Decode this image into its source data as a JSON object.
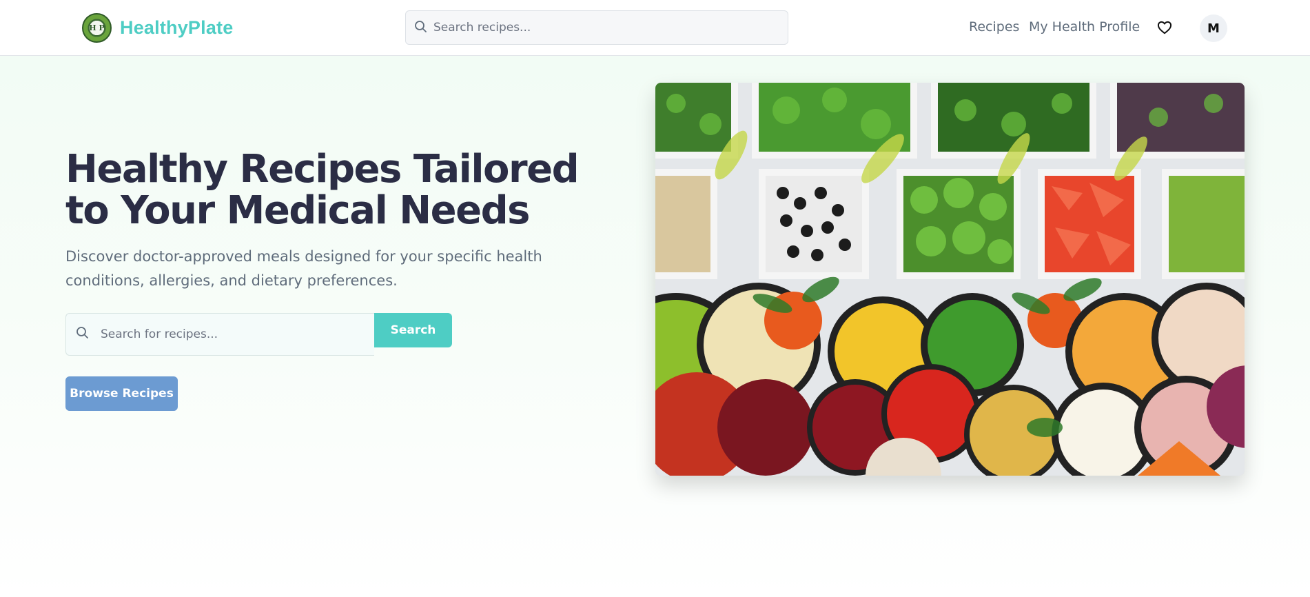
{
  "header": {
    "brand": "HealthyPlate",
    "logo_text": "H P",
    "search_placeholder": "Search recipes...",
    "nav": {
      "recipes": "Recipes",
      "profile": "My Health Profile"
    },
    "favorites_icon": "heart-icon",
    "avatar_initial": "M"
  },
  "hero": {
    "title": "Healthy Recipes Tailored to Your Medical Needs",
    "subtitle": "Discover doctor-approved meals designed for your specific health conditions, allergies, and dietary preferences.",
    "search_placeholder": "Search for recipes...",
    "search_button": "Search",
    "browse_button": "Browse Recipes",
    "image_alt": "Assorted bowls of fresh vegetables"
  },
  "colors": {
    "brand": "#4ecdc4",
    "browse": "#6c9bd2",
    "title": "#2b2d45",
    "text": "#5f6c7b"
  }
}
